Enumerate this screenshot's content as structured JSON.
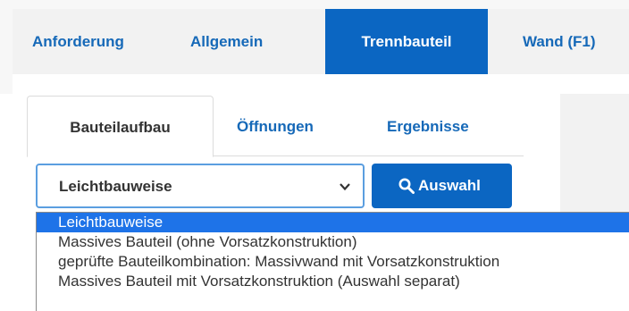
{
  "nav": {
    "tabs": [
      {
        "label": "Anforderung"
      },
      {
        "label": "Allgemein"
      },
      {
        "label": "Trennbauteil"
      },
      {
        "label": "Wand (F1)"
      }
    ],
    "active_index": 2
  },
  "subtabs": {
    "tabs": [
      {
        "label": "Bauteilaufbau"
      },
      {
        "label": "Öffnungen"
      },
      {
        "label": "Ergebnisse"
      }
    ],
    "active_index": 0
  },
  "construction_select": {
    "selected_value": "Leichtbauweise",
    "options": [
      "Leichtbauweise",
      "Massives Bauteil (ohne Vorsatzkonstruktion)",
      "geprüfte Bauteilkombination: Massivwand mit Vorsatzkonstruktion",
      "Massives Bauteil mit Vorsatzkonstruktion (Auswahl separat)"
    ],
    "highlighted_index": 0
  },
  "select_button": {
    "label": "Auswahl",
    "icon": "search-icon"
  },
  "colors": {
    "primary": "#0b66c2",
    "link": "#1669b8",
    "highlight": "#1e73e8"
  }
}
